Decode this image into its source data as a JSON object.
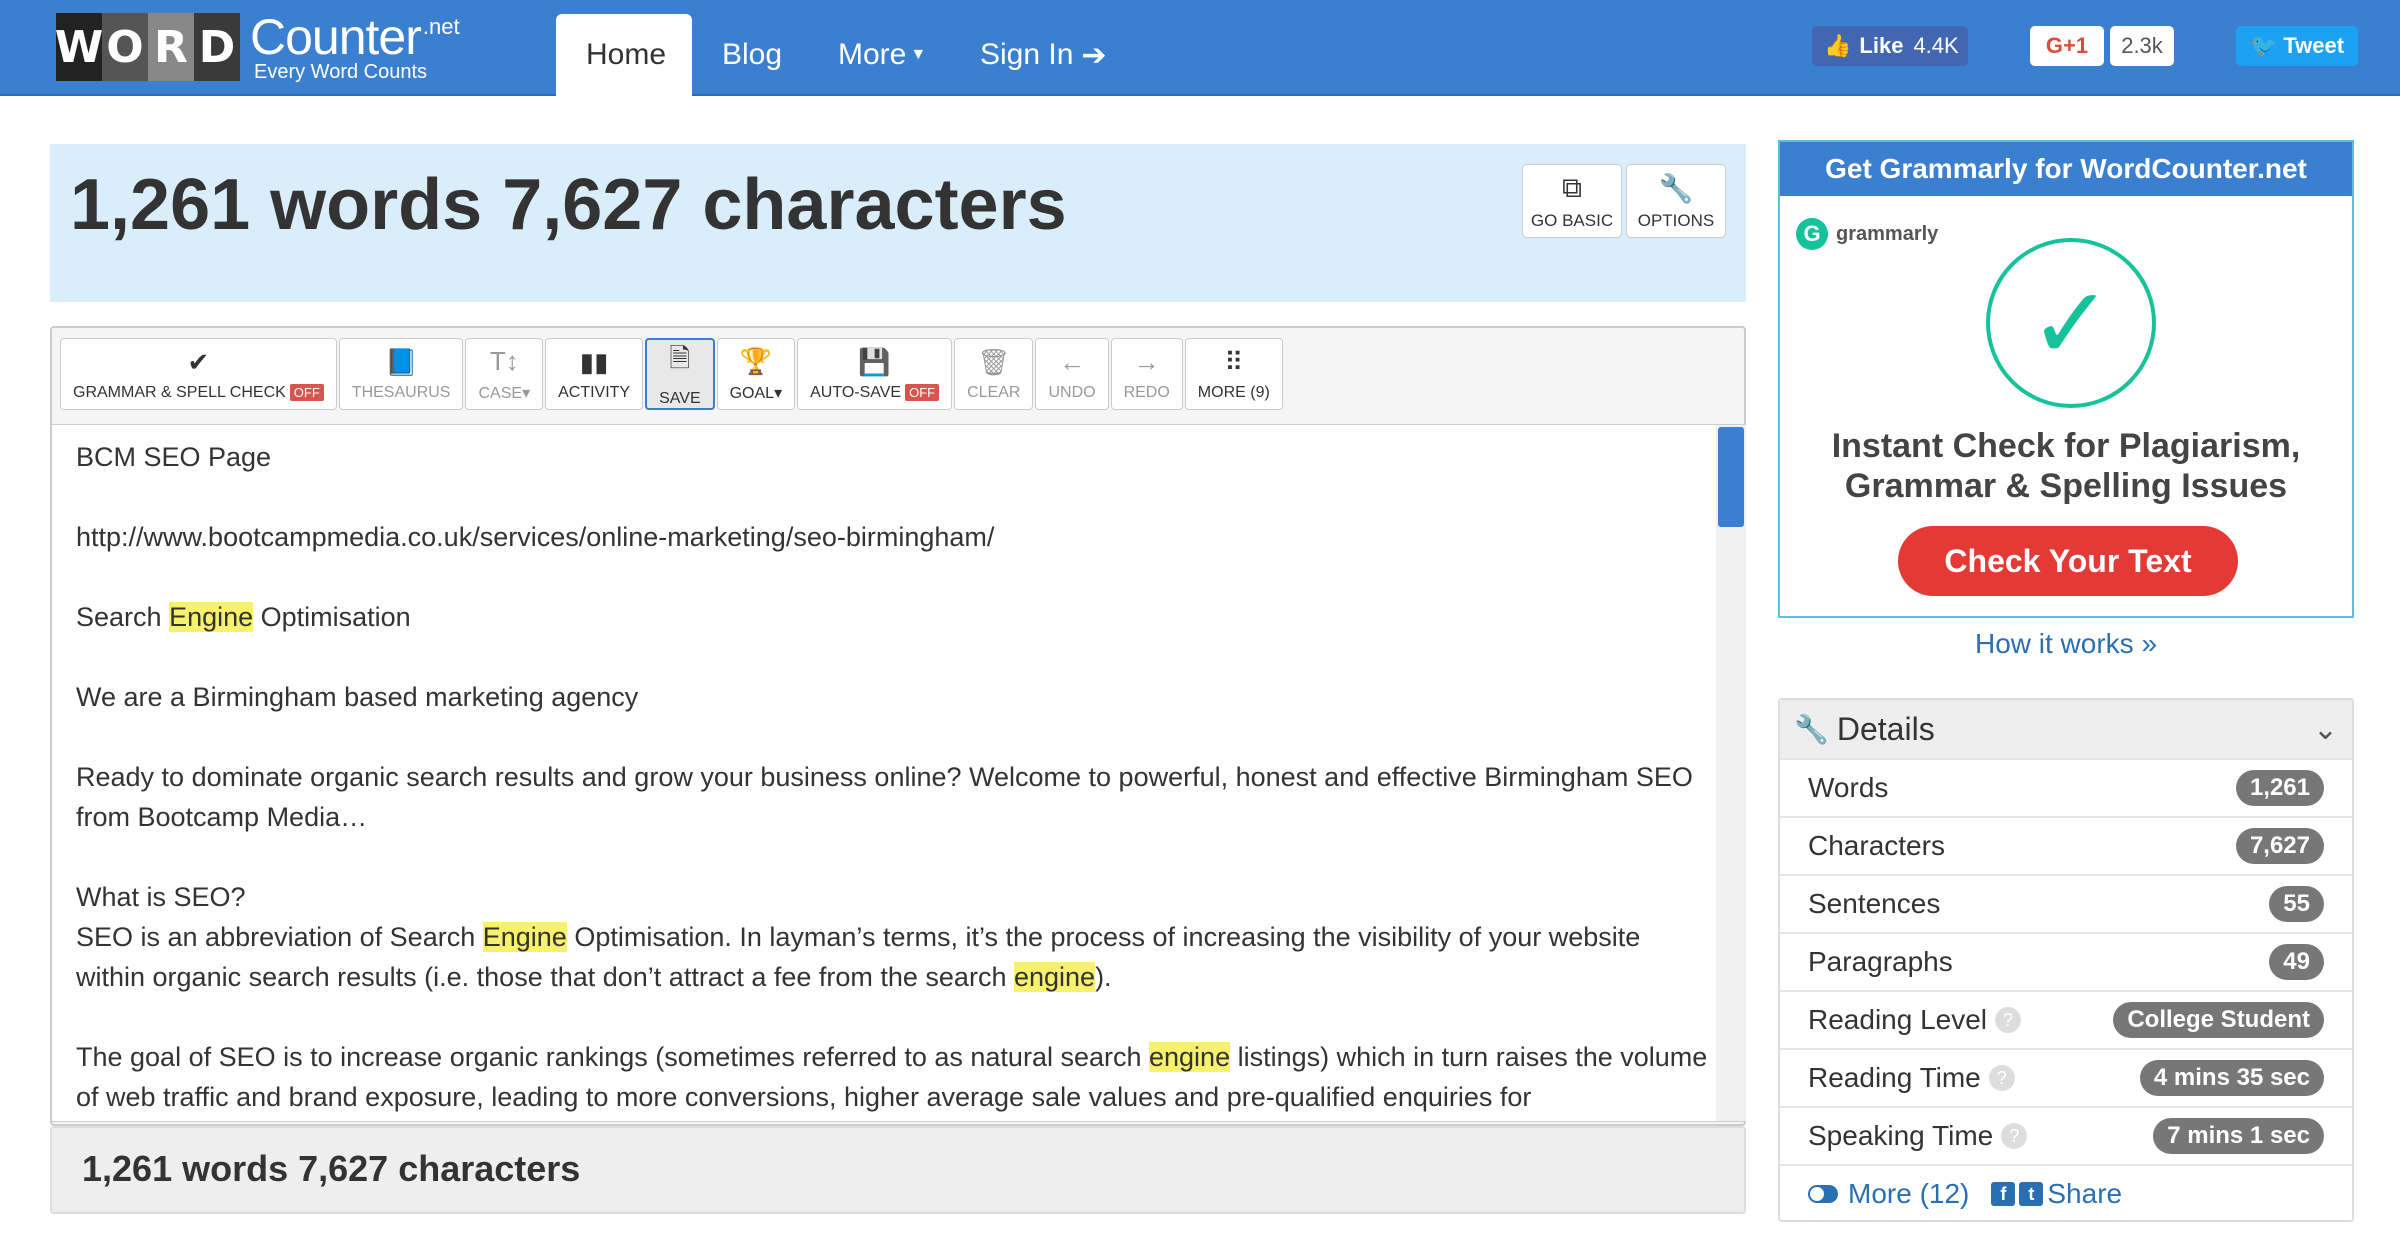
{
  "logo": {
    "tiles": [
      "W",
      "O",
      "R",
      "D"
    ],
    "counter": "Counter",
    "net": ".net",
    "tagline": "Every Word Counts"
  },
  "nav": {
    "home": "Home",
    "blog": "Blog",
    "more": "More",
    "signin": "Sign In"
  },
  "social": {
    "fb_like": "Like",
    "fb_count": "4.4K",
    "gplus": "G+1",
    "gplus_count": "2.3k",
    "tweet": "Tweet"
  },
  "header": {
    "count_text": "1,261 words 7,627 characters",
    "go_basic": "GO BASIC",
    "options": "OPTIONS"
  },
  "toolbar": {
    "grammar": "GRAMMAR & SPELL CHECK",
    "grammar_state": "OFF",
    "thesaurus": "THESAURUS",
    "case": "CASE",
    "activity": "ACTIVITY",
    "save": "SAVE",
    "goal": "GOAL",
    "autosave": "AUTO-SAVE",
    "autosave_state": "OFF",
    "clear": "CLEAR",
    "undo": "UNDO",
    "redo": "REDO",
    "more": "MORE (9)"
  },
  "editor": {
    "line1": "BCM SEO Page",
    "line2": "http://www.bootcampmedia.co.uk/services/online-marketing/seo-birmingham/",
    "line3_a": "Search ",
    "line3_hl": "Engine",
    "line3_b": " Optimisation",
    "line4": "We are a Birmingham based marketing agency",
    "line5": "Ready to dominate organic search results and grow your business online? Welcome to powerful, honest and effective Birmingham SEO from Bootcamp Media…",
    "line6_q": "What is SEO?",
    "line6_a": "SEO is an abbreviation of Search ",
    "line6_hl1": "Engine",
    "line6_b": " Optimisation. In layman’s terms, it’s the process of increasing the visibility of your website within organic search results (i.e. those that don’t attract a fee from the search ",
    "line6_hl2": "engine",
    "line6_c": ").",
    "line7_a": "The goal of SEO is to increase organic rankings (sometimes referred to as natural search ",
    "line7_hl": "engine",
    "line7_b": " listings) which in turn raises the volume of web traffic and brand exposure, leading to more conversions, higher average sale values and pre-qualified enquiries for"
  },
  "footer": {
    "count_text": "1,261 words 7,627 characters"
  },
  "ad": {
    "heading": "Get Grammarly for WordCounter.net",
    "brand": "grammarly",
    "title_line1": "Instant Check for Plagiarism,",
    "title_line2": "Grammar & Spelling Issues",
    "button": "Check Your Text",
    "how": "How it works »"
  },
  "details": {
    "title": "Details",
    "rows": [
      {
        "label": "Words",
        "value": "1,261"
      },
      {
        "label": "Characters",
        "value": "7,627"
      },
      {
        "label": "Sentences",
        "value": "55"
      },
      {
        "label": "Paragraphs",
        "value": "49"
      },
      {
        "label": "Reading Level",
        "value": "College Student"
      },
      {
        "label": "Reading Time",
        "value": "4 mins 35 sec"
      },
      {
        "label": "Speaking Time",
        "value": "7 mins 1 sec"
      }
    ],
    "more": "More (12)",
    "share": "Share"
  },
  "colors": {
    "brand_blue": "#3b7fd0",
    "header_bg": "#d9eefa",
    "highlight": "#f7f16b",
    "ad_button": "#e53935",
    "grammarly_green": "#15c39a"
  },
  "icons": [
    "external-link-icon",
    "wrench-icon",
    "check-icon",
    "book-icon",
    "text-case-icon",
    "bar-chart-icon",
    "save-file-icon",
    "trophy-icon",
    "floppy-disk-icon",
    "trash-icon",
    "arrow-left-icon",
    "arrow-right-icon",
    "grid-icon",
    "sign-in-icon",
    "thumbs-up-icon",
    "twitter-icon",
    "chevron-down-icon",
    "question-icon",
    "toggle-icon",
    "facebook-icon"
  ]
}
